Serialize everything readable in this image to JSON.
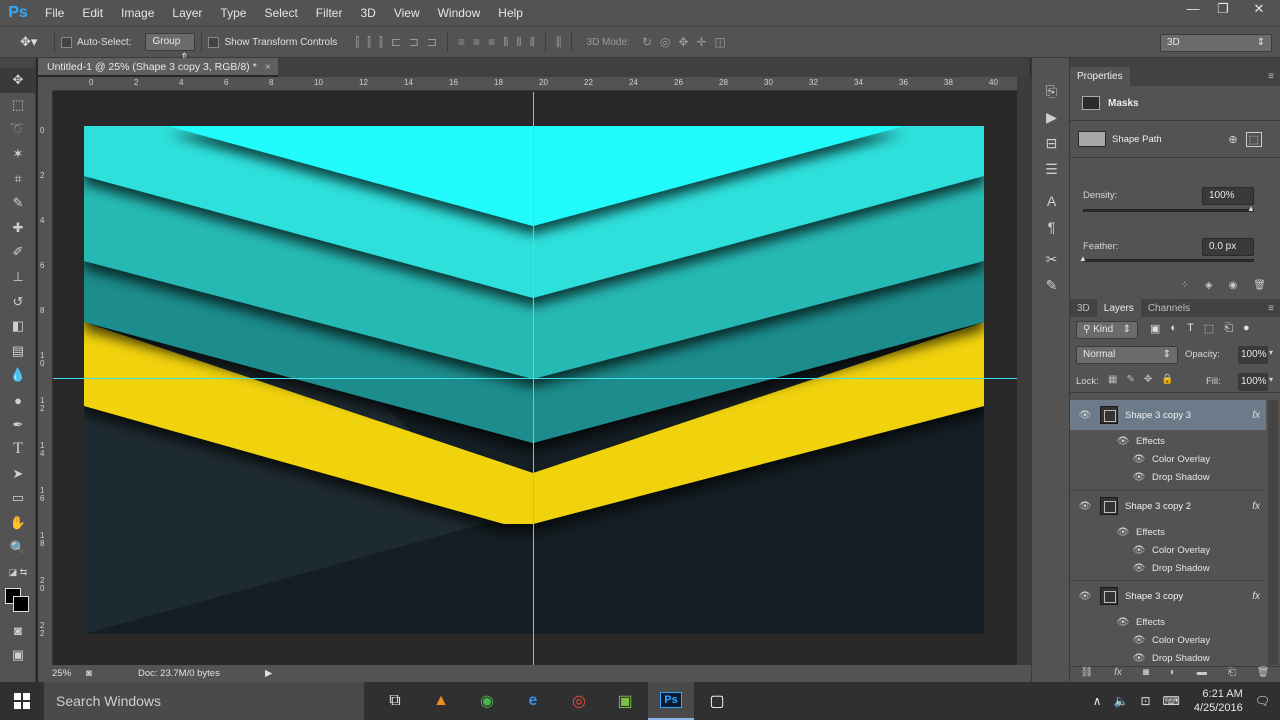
{
  "app": {
    "logo": "Ps"
  },
  "menu": [
    "File",
    "Edit",
    "Image",
    "Layer",
    "Type",
    "Select",
    "Filter",
    "3D",
    "View",
    "Window",
    "Help"
  ],
  "window_controls": {
    "minimize": "—",
    "restore": "❐",
    "close": "✕"
  },
  "options": {
    "auto_select_label": "Auto-Select:",
    "auto_select_value": "Group",
    "show_transform_label": "Show Transform Controls",
    "mode_3d_label": "3D Mode:",
    "workspace_value": "3D"
  },
  "document": {
    "tab_title": "Untitled-1 @ 25% (Shape 3 copy 3, RGB/8) *",
    "tab_close": "×",
    "zoom": "25%",
    "doc_info": "Doc: 23.7M/0 bytes"
  },
  "rulers": {
    "h_ticks": [
      "0",
      "2",
      "4",
      "6",
      "8",
      "10",
      "12",
      "14",
      "16",
      "18",
      "20",
      "22",
      "24",
      "26",
      "28",
      "30",
      "32",
      "34",
      "36",
      "38",
      "40"
    ],
    "v_ticks": [
      "0",
      "2",
      "4",
      "6",
      "8",
      "1\n0",
      "1\n2",
      "1\n4",
      "1\n6",
      "1\n8",
      "2\n0",
      "2\n2"
    ]
  },
  "canvas": {
    "colors": {
      "band1": "#24fbfb",
      "band2": "#2de0dc",
      "band3": "#26b9b4",
      "band4": "#1f8c8c",
      "yellow": "#f0d20a",
      "dark_left": "#1e2a31",
      "dark_right": "#141e24",
      "guide": "#3ee0ee"
    }
  },
  "properties": {
    "title": "Properties",
    "masks_label": "Masks",
    "shape_path_label": "Shape Path",
    "density_label": "Density:",
    "density_value": "100%",
    "feather_label": "Feather:",
    "feather_value": "0.0 px"
  },
  "layers_panel": {
    "tabs": [
      "3D",
      "Layers",
      "Channels"
    ],
    "filter_kind": "Kind",
    "blend_mode": "Normal",
    "opacity_label": "Opacity:",
    "opacity_value": "100%",
    "lock_label": "Lock:",
    "fill_label": "Fill:",
    "fill_value": "100%",
    "layers": [
      {
        "name": "Shape 3 copy 3",
        "fx": "fx",
        "effects_label": "Effects",
        "effects": [
          "Color Overlay",
          "Drop Shadow"
        ],
        "selected": true
      },
      {
        "name": "Shape 3 copy 2",
        "fx": "fx",
        "effects_label": "Effects",
        "effects": [
          "Color Overlay",
          "Drop Shadow"
        ],
        "selected": false
      },
      {
        "name": "Shape 3 copy",
        "fx": "fx",
        "effects_label": "Effects",
        "effects": [
          "Color Overlay",
          "Drop Shadow"
        ],
        "selected": false
      }
    ]
  },
  "taskbar": {
    "search_placeholder": "Search Windows",
    "time": "6:21 AM",
    "date": "4/25/2016"
  }
}
